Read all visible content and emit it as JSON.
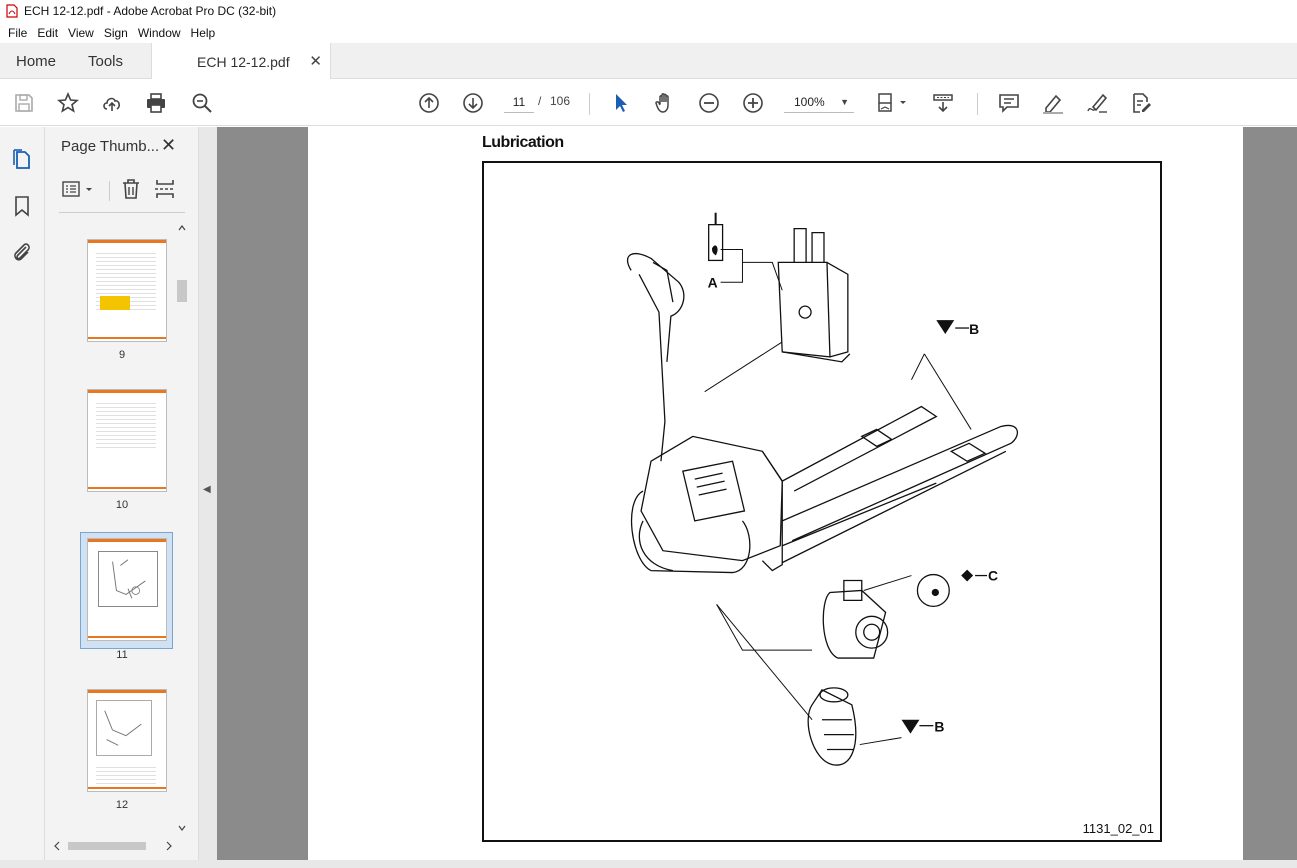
{
  "window": {
    "title": "ECH 12-12.pdf - Adobe Acrobat Pro DC (32-bit)"
  },
  "menu": [
    "File",
    "Edit",
    "View",
    "Sign",
    "Window",
    "Help"
  ],
  "tabs": {
    "home": "Home",
    "tools": "Tools",
    "document": "ECH 12-12.pdf",
    "close_glyph": "✕"
  },
  "toolbar": {
    "current_page": "11",
    "page_separator": "/",
    "total_pages": "106",
    "zoom": "100%"
  },
  "panel": {
    "title": "Page Thumb...",
    "close_glyph": "✕",
    "thumbnails": [
      {
        "label": "9"
      },
      {
        "label": "10"
      },
      {
        "label": "11",
        "selected": true
      },
      {
        "label": "12"
      }
    ]
  },
  "page": {
    "heading": "Lubrication",
    "callouts": {
      "a": "A",
      "b1": "B",
      "b2": "B",
      "c": "C"
    },
    "figure_id": "1131_02_01"
  },
  "colors": {
    "accent": "#e87722",
    "selection": "#cfe1f2",
    "viewer_bg": "#8b8b8b"
  }
}
